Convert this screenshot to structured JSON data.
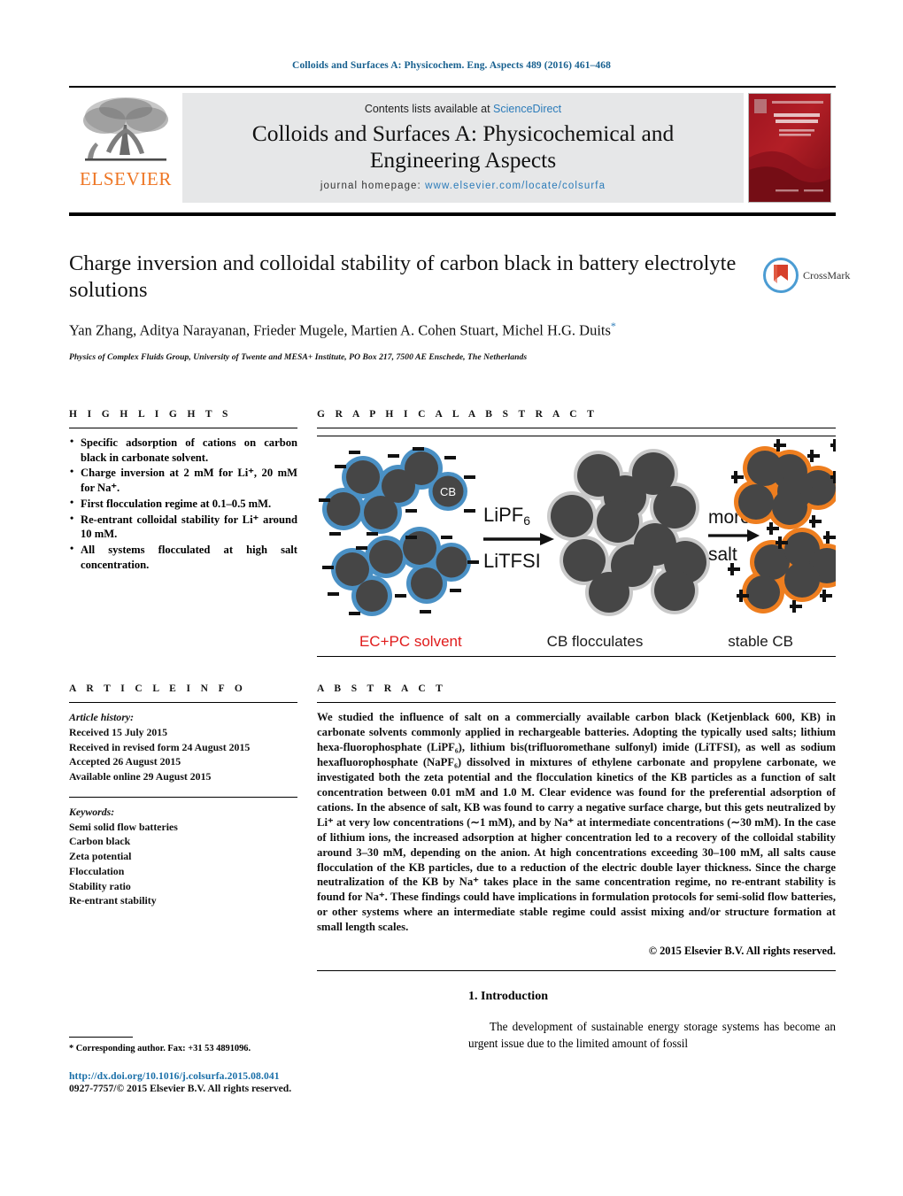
{
  "running_head": "Colloids and Surfaces A: Physicochem. Eng. Aspects 489 (2016) 461–468",
  "masthead": {
    "publisher": "ELSEVIER",
    "contents_prefix": "Contents lists available at",
    "contents_link": "ScienceDirect",
    "journal_title_line1": "Colloids and Surfaces A: Physicochemical and",
    "journal_title_line2": "Engineering Aspects",
    "homepage_label": "journal homepage:",
    "homepage_url": "www.elsevier.com/locate/colsurfa"
  },
  "article": {
    "title": "Charge inversion and colloidal stability of carbon black in battery electrolyte solutions",
    "authors": "Yan Zhang, Aditya Narayanan, Frieder Mugele, Martien A. Cohen Stuart, Michel H.G. Duits",
    "affiliation": "Physics of Complex Fluids Group, University of Twente and MESA+ Institute, PO Box 217, 7500 AE Enschede, The Netherlands",
    "crossmark_label": "CrossMark"
  },
  "highlights": {
    "heading": "H I G H L I G H T S",
    "items": [
      "Specific adsorption of cations on carbon black in carbonate solvent.",
      "Charge inversion at 2 mM for Li⁺, 20 mM for Na⁺.",
      "First flocculation regime at 0.1–0.5 mM.",
      "Re-entrant colloidal stability for Li⁺ around 10 mM.",
      "All systems flocculated at high salt concentration."
    ]
  },
  "graphical_abstract": {
    "heading": "G R A P H I C A L   A B S T R A C T",
    "particle_label": "CB",
    "arrow1_top": "LiPF₆",
    "arrow1_bottom": "LiTFSI",
    "arrow2_top": "more",
    "arrow2_bottom": "salt",
    "caption_left": "EC+PC solvent",
    "caption_mid": "CB flocculates",
    "caption_right": "stable CB",
    "negative_sign": "–",
    "positive_sign": "+",
    "colors": {
      "particle": "#464646",
      "negative_shell": "#4a90c4",
      "neutral_shell": "#c9c9c9",
      "positive_shell": "#ee7e1f",
      "caption_left_color": "#e01b1b"
    }
  },
  "article_info": {
    "heading": "A R T I C L E   I N F O",
    "history_label": "Article history:",
    "history": [
      "Received 15 July 2015",
      "Received in revised form 24 August 2015",
      "Accepted 26 August 2015",
      "Available online 29 August 2015"
    ],
    "keywords_label": "Keywords:",
    "keywords": [
      "Semi solid flow batteries",
      "Carbon black",
      "Zeta potential",
      "Flocculation",
      "Stability ratio",
      "Re-entrant stability"
    ]
  },
  "abstract": {
    "heading": "A B S T R A C T",
    "text": "We studied the influence of salt on a commercially available carbon black (Ketjenblack 600, KB) in carbonate solvents commonly applied in rechargeable batteries. Adopting the typically used salts; lithium hexa-fluorophosphate (LiPF₆), lithium bis(trifluoromethane sulfonyl) imide (LiTFSI), as well as sodium hexafluorophosphate (NaPF₆) dissolved in mixtures of ethylene carbonate and propylene carbonate, we investigated both the zeta potential and the flocculation kinetics of the KB particles as a function of salt concentration between 0.01 mM and 1.0 M. Clear evidence was found for the preferential adsorption of cations. In the absence of salt, KB was found to carry a negative surface charge, but this gets neutralized by Li⁺ at very low concentrations (∼1 mM), and by Na⁺ at intermediate concentrations (∼30 mM). In the case of lithium ions, the increased adsorption at higher concentration led to a recovery of the colloidal stability around 3–30 mM, depending on the anion. At high concentrations exceeding 30–100 mM, all salts cause flocculation of the KB particles, due to a reduction of the electric double layer thickness. Since the charge neutralization of the KB by Na⁺ takes place in the same concentration regime, no re-entrant stability is found for Na⁺. These findings could have implications in formulation protocols for semi-solid flow batteries, or other systems where an intermediate stable regime could assist mixing and/or structure formation at small length scales.",
    "copyright": "© 2015 Elsevier B.V. All rights reserved."
  },
  "introduction": {
    "heading": "1.  Introduction",
    "text": "The development of sustainable energy storage systems has become an urgent issue due to the limited amount of fossil"
  },
  "footnote": "* Corresponding author. Fax: +31 53 4891096.",
  "footer": {
    "doi": "http://dx.doi.org/10.1016/j.colsurfa.2015.08.041",
    "issn": "0927-7757/© 2015 Elsevier B.V. All rights reserved."
  }
}
